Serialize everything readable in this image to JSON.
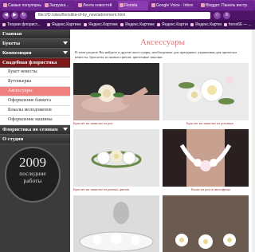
{
  "browser": {
    "tabs": [
      {
        "label": "Самые популярные"
      },
      {
        "label": "Загрузка..."
      },
      {
        "label": "Лента новостей"
      },
      {
        "label": "Florista"
      },
      {
        "label": "Google Voice - Inbox"
      },
      {
        "label": "Blogger: Панель инстр."
      }
    ],
    "url": "file:///D:/sites/floristika-of-by_new/adornment.html",
    "bookmarks": [
      {
        "label": "Теории флорист..."
      },
      {
        "label": "Яндекс.Картинки..."
      },
      {
        "label": "Яндекс.Картинки..."
      },
      {
        "label": "Яндекс.Картинки..."
      },
      {
        "label": "Яндекс.Картинки..."
      },
      {
        "label": "Яндекс.Картинки..."
      },
      {
        "label": "forex66 — ..."
      }
    ]
  },
  "sidebar": {
    "items": [
      {
        "label": "Главная"
      },
      {
        "label": "Букеты"
      },
      {
        "label": "Композиции"
      },
      {
        "label": "Свадебная флористика"
      }
    ],
    "subitems": [
      {
        "label": "Букет невесты"
      },
      {
        "label": "Бутоньерка"
      },
      {
        "label": "Аксессуары"
      },
      {
        "label": "Оформление банкета"
      },
      {
        "label": "Бокалы молодоженов"
      },
      {
        "label": "Оформление машины"
      }
    ],
    "bottom_items": [
      {
        "label": "Флористика по сезонам"
      },
      {
        "label": "О студии"
      }
    ],
    "badge": {
      "year": "2009",
      "line1": "последние",
      "line2": "работы"
    }
  },
  "main": {
    "title": "Аксессуары",
    "intro": "В этом разделе Вы найдете и другие аксессуары, необходимые для праздника: украшения для прически невесты, браслеты из живых цветов, цветочные заколки.",
    "photos": [
      {
        "caption": "Браслет на запястье из роз"
      },
      {
        "caption": "Браслет на запястье из розовых"
      },
      {
        "caption": "Браслет на запястье из разных цветов"
      },
      {
        "caption": "Колье из роз и гипсофилы"
      }
    ]
  }
}
